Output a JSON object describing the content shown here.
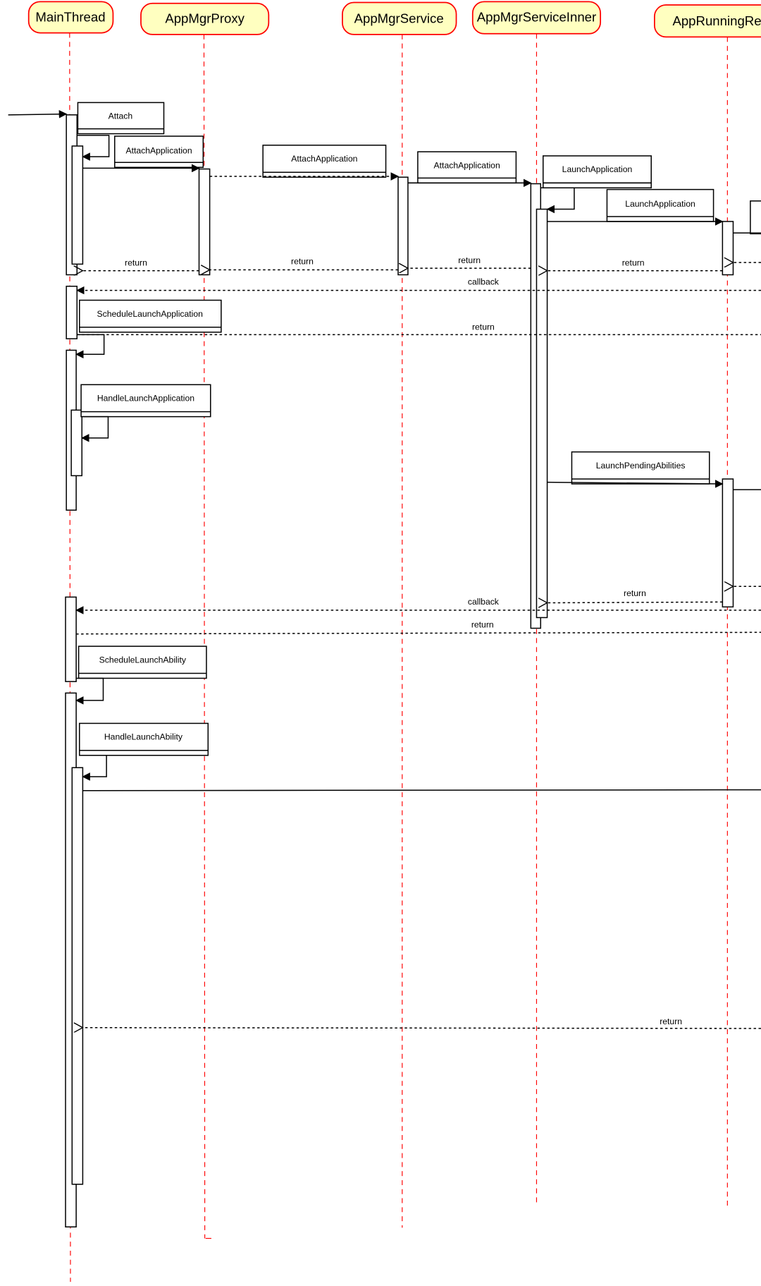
{
  "participants": [
    "MainThread",
    "AppMgrProxy",
    "AppMgrService",
    "AppMgrServiceInner",
    "AppRunningRec"
  ],
  "colors": {
    "participant_fill": "#ffffc0",
    "participant_border": "#ff0000",
    "lifeline": "#ff0000",
    "line": "#000000"
  },
  "messages": {
    "attach": "Attach",
    "attach_app_1": "AttachApplication",
    "attach_app_2": "AttachApplication",
    "attach_app_3": "AttachApplication",
    "launch_app_1": "LaunchApplication",
    "launch_app_2": "LaunchApplication",
    "schedule_launch_app": "ScheduleLaunchApplication",
    "handle_launch_app": "HandleLaunchApplication",
    "launch_pending": "LaunchPendingAbilities",
    "schedule_launch_ability": "ScheduleLaunchAbility",
    "handle_launch_ability": "HandleLaunchAbility",
    "return": "return",
    "callback": "callback"
  }
}
